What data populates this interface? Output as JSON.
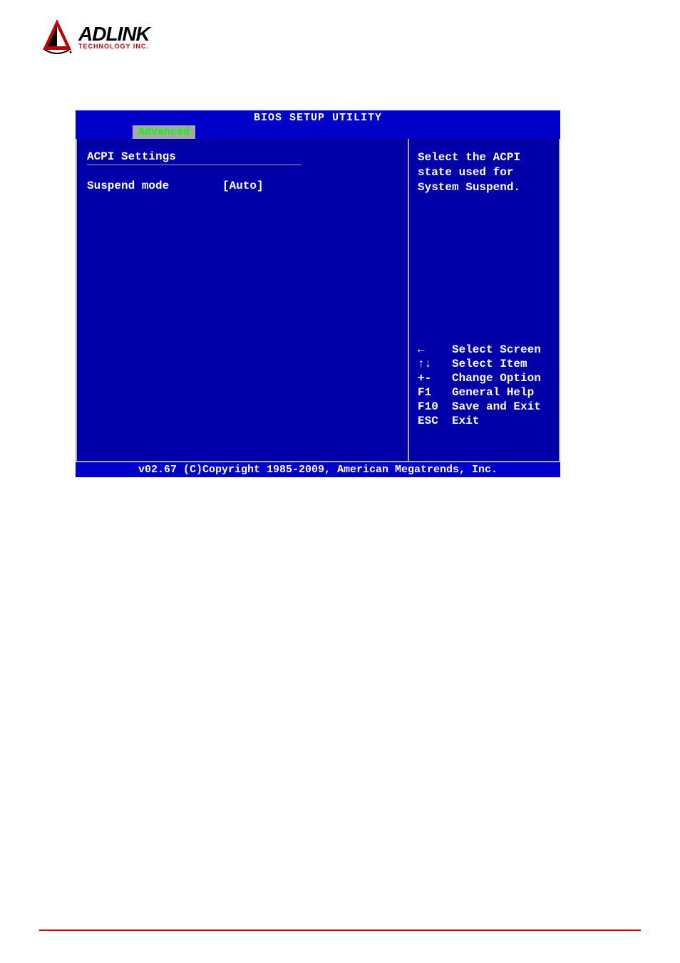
{
  "logo": {
    "name": "ADLINK",
    "tagline": "TECHNOLOGY INC."
  },
  "bios": {
    "title": "BIOS SETUP UTILITY",
    "tab": "Advanced",
    "section_title": "ACPI Settings",
    "setting": {
      "label": "Suspend mode",
      "value": "[Auto]"
    },
    "help_text": "Select the ACPI state used for System Suspend.",
    "keys": [
      {
        "key": "←",
        "desc": "Select Screen"
      },
      {
        "key": "↑↓",
        "desc": "Select Item"
      },
      {
        "key": "+-",
        "desc": "Change Option"
      },
      {
        "key": "F1",
        "desc": "General Help"
      },
      {
        "key": "F10",
        "desc": "Save and Exit"
      },
      {
        "key": "ESC",
        "desc": "Exit"
      }
    ],
    "footer": "v02.67 (C)Copyright 1985-2009, American Megatrends, Inc."
  }
}
